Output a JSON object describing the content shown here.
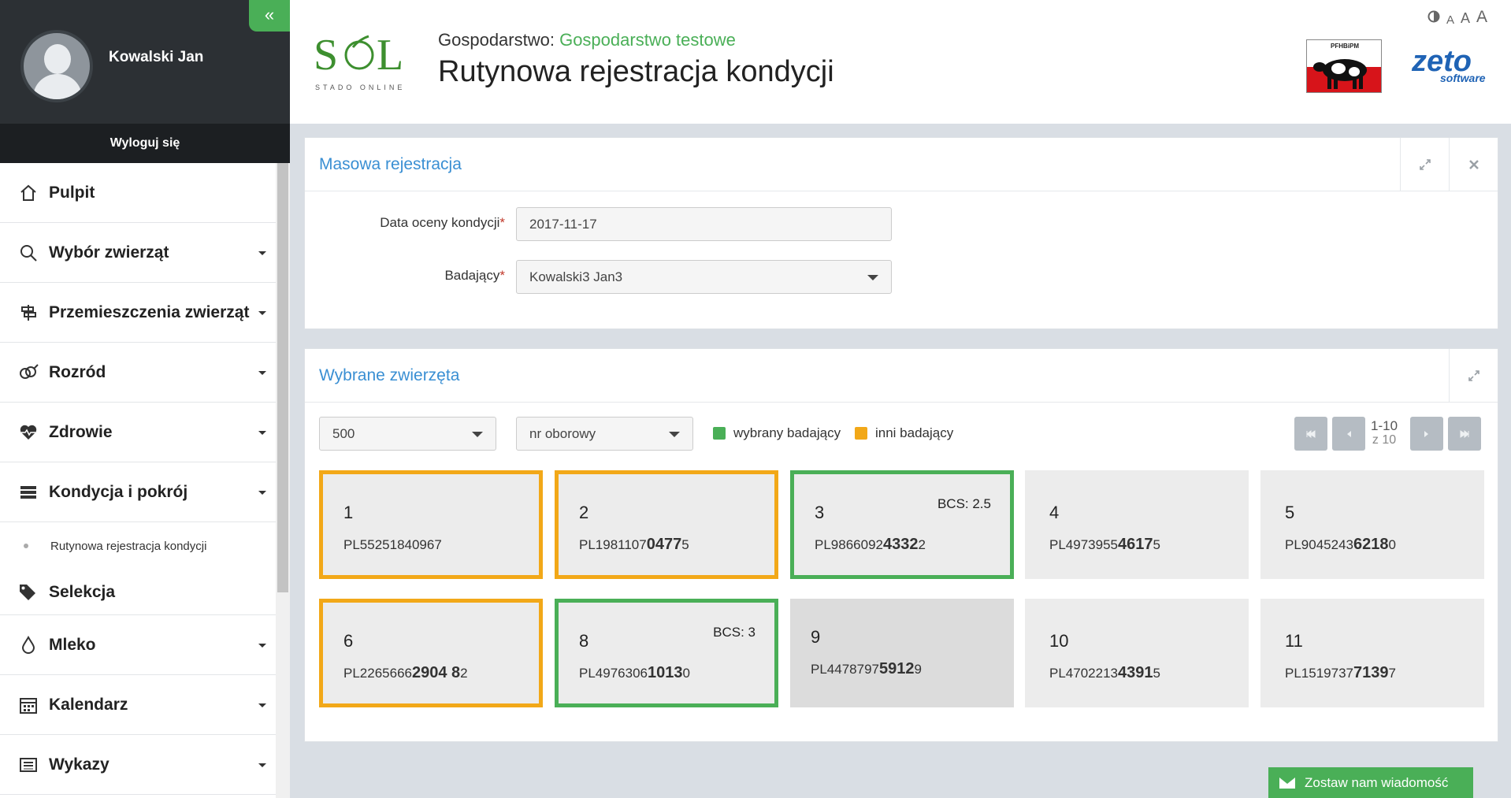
{
  "sidebar": {
    "user_name": "Kowalski Jan",
    "collapse_icon": "«",
    "logout_label": "Wyloguj się",
    "items": [
      {
        "label": "Pulpit",
        "icon": "home-icon"
      },
      {
        "label": "Wybór zwierząt",
        "icon": "search-icon"
      },
      {
        "label": "Przemieszczenia zwierząt",
        "icon": "signpost-icon"
      },
      {
        "label": "Rozród",
        "icon": "gender-icon"
      },
      {
        "label": "Zdrowie",
        "icon": "heartbeat-icon"
      },
      {
        "label": "Kondycja i pokrój",
        "icon": "list-icon"
      },
      {
        "label": "Selekcja",
        "icon": "tags-icon"
      },
      {
        "label": "Mleko",
        "icon": "drop-icon"
      },
      {
        "label": "Kalendarz",
        "icon": "calendar-icon"
      },
      {
        "label": "Wykazy",
        "icon": "report-list-icon"
      }
    ],
    "sub_item": "Rutynowa rejestracja kondycji"
  },
  "header": {
    "logo_text": "STADO ONLINE",
    "farm_prefix": "Gospodarstwo: ",
    "farm_name": "Gospodarstwo testowe",
    "title": "Rutynowa rejestracja kondycji",
    "font_small": "A",
    "font_medium": "A",
    "font_large": "A",
    "pfhb_text": "PFHBiPM",
    "zeto_main": "zeto",
    "zeto_sub": "software"
  },
  "mass_panel": {
    "title": "Masowa rejestracja",
    "date_label": "Data oceny kondycji",
    "date_value": "2017-11-17",
    "examiner_label": "Badający",
    "examiner_value": "Kowalski3 Jan3",
    "required_mark": "*"
  },
  "animals_panel": {
    "title": "Wybrane zwierzęta",
    "page_size": "500",
    "sort_by": "nr oborowy",
    "legend_own": "wybrany badający",
    "legend_other": "inni badający",
    "pager_range": "1-10",
    "pager_total": "z 10",
    "colors": {
      "own": "#4aaf57",
      "other": "#f2a818"
    },
    "cards": [
      {
        "num": "1",
        "id_pre": "PL55251840967",
        "id_bold": "",
        "id_post": "",
        "bcs": "",
        "status": "other"
      },
      {
        "num": "2",
        "id_pre": "PL1981107",
        "id_bold": "0477",
        "id_post": "5",
        "bcs": "",
        "status": "other"
      },
      {
        "num": "3",
        "id_pre": "PL9866092",
        "id_bold": "4332",
        "id_post": "2",
        "bcs": "BCS: 2.5",
        "status": "own"
      },
      {
        "num": "4",
        "id_pre": "PL4973955",
        "id_bold": "4617",
        "id_post": "5",
        "bcs": "",
        "status": "none"
      },
      {
        "num": "5",
        "id_pre": "PL9045243",
        "id_bold": "6218",
        "id_post": "0",
        "bcs": "",
        "status": "none"
      },
      {
        "num": "6",
        "id_pre": "PL2265666",
        "id_bold": "2904 8",
        "id_post": "2",
        "bcs": "",
        "status": "other"
      },
      {
        "num": "8",
        "id_pre": "PL4976306",
        "id_bold": "1013",
        "id_post": "0",
        "bcs": "BCS: 3",
        "status": "own"
      },
      {
        "num": "9",
        "id_pre": "PL4478797",
        "id_bold": "5912",
        "id_post": "9",
        "bcs": "",
        "status": "selected"
      },
      {
        "num": "10",
        "id_pre": "PL4702213",
        "id_bold": "4391",
        "id_post": "5",
        "bcs": "",
        "status": "none"
      },
      {
        "num": "11",
        "id_pre": "PL1519737",
        "id_bold": "7139",
        "id_post": "7",
        "bcs": "",
        "status": "none"
      }
    ]
  },
  "contact_button": "Zostaw nam wiadomość"
}
